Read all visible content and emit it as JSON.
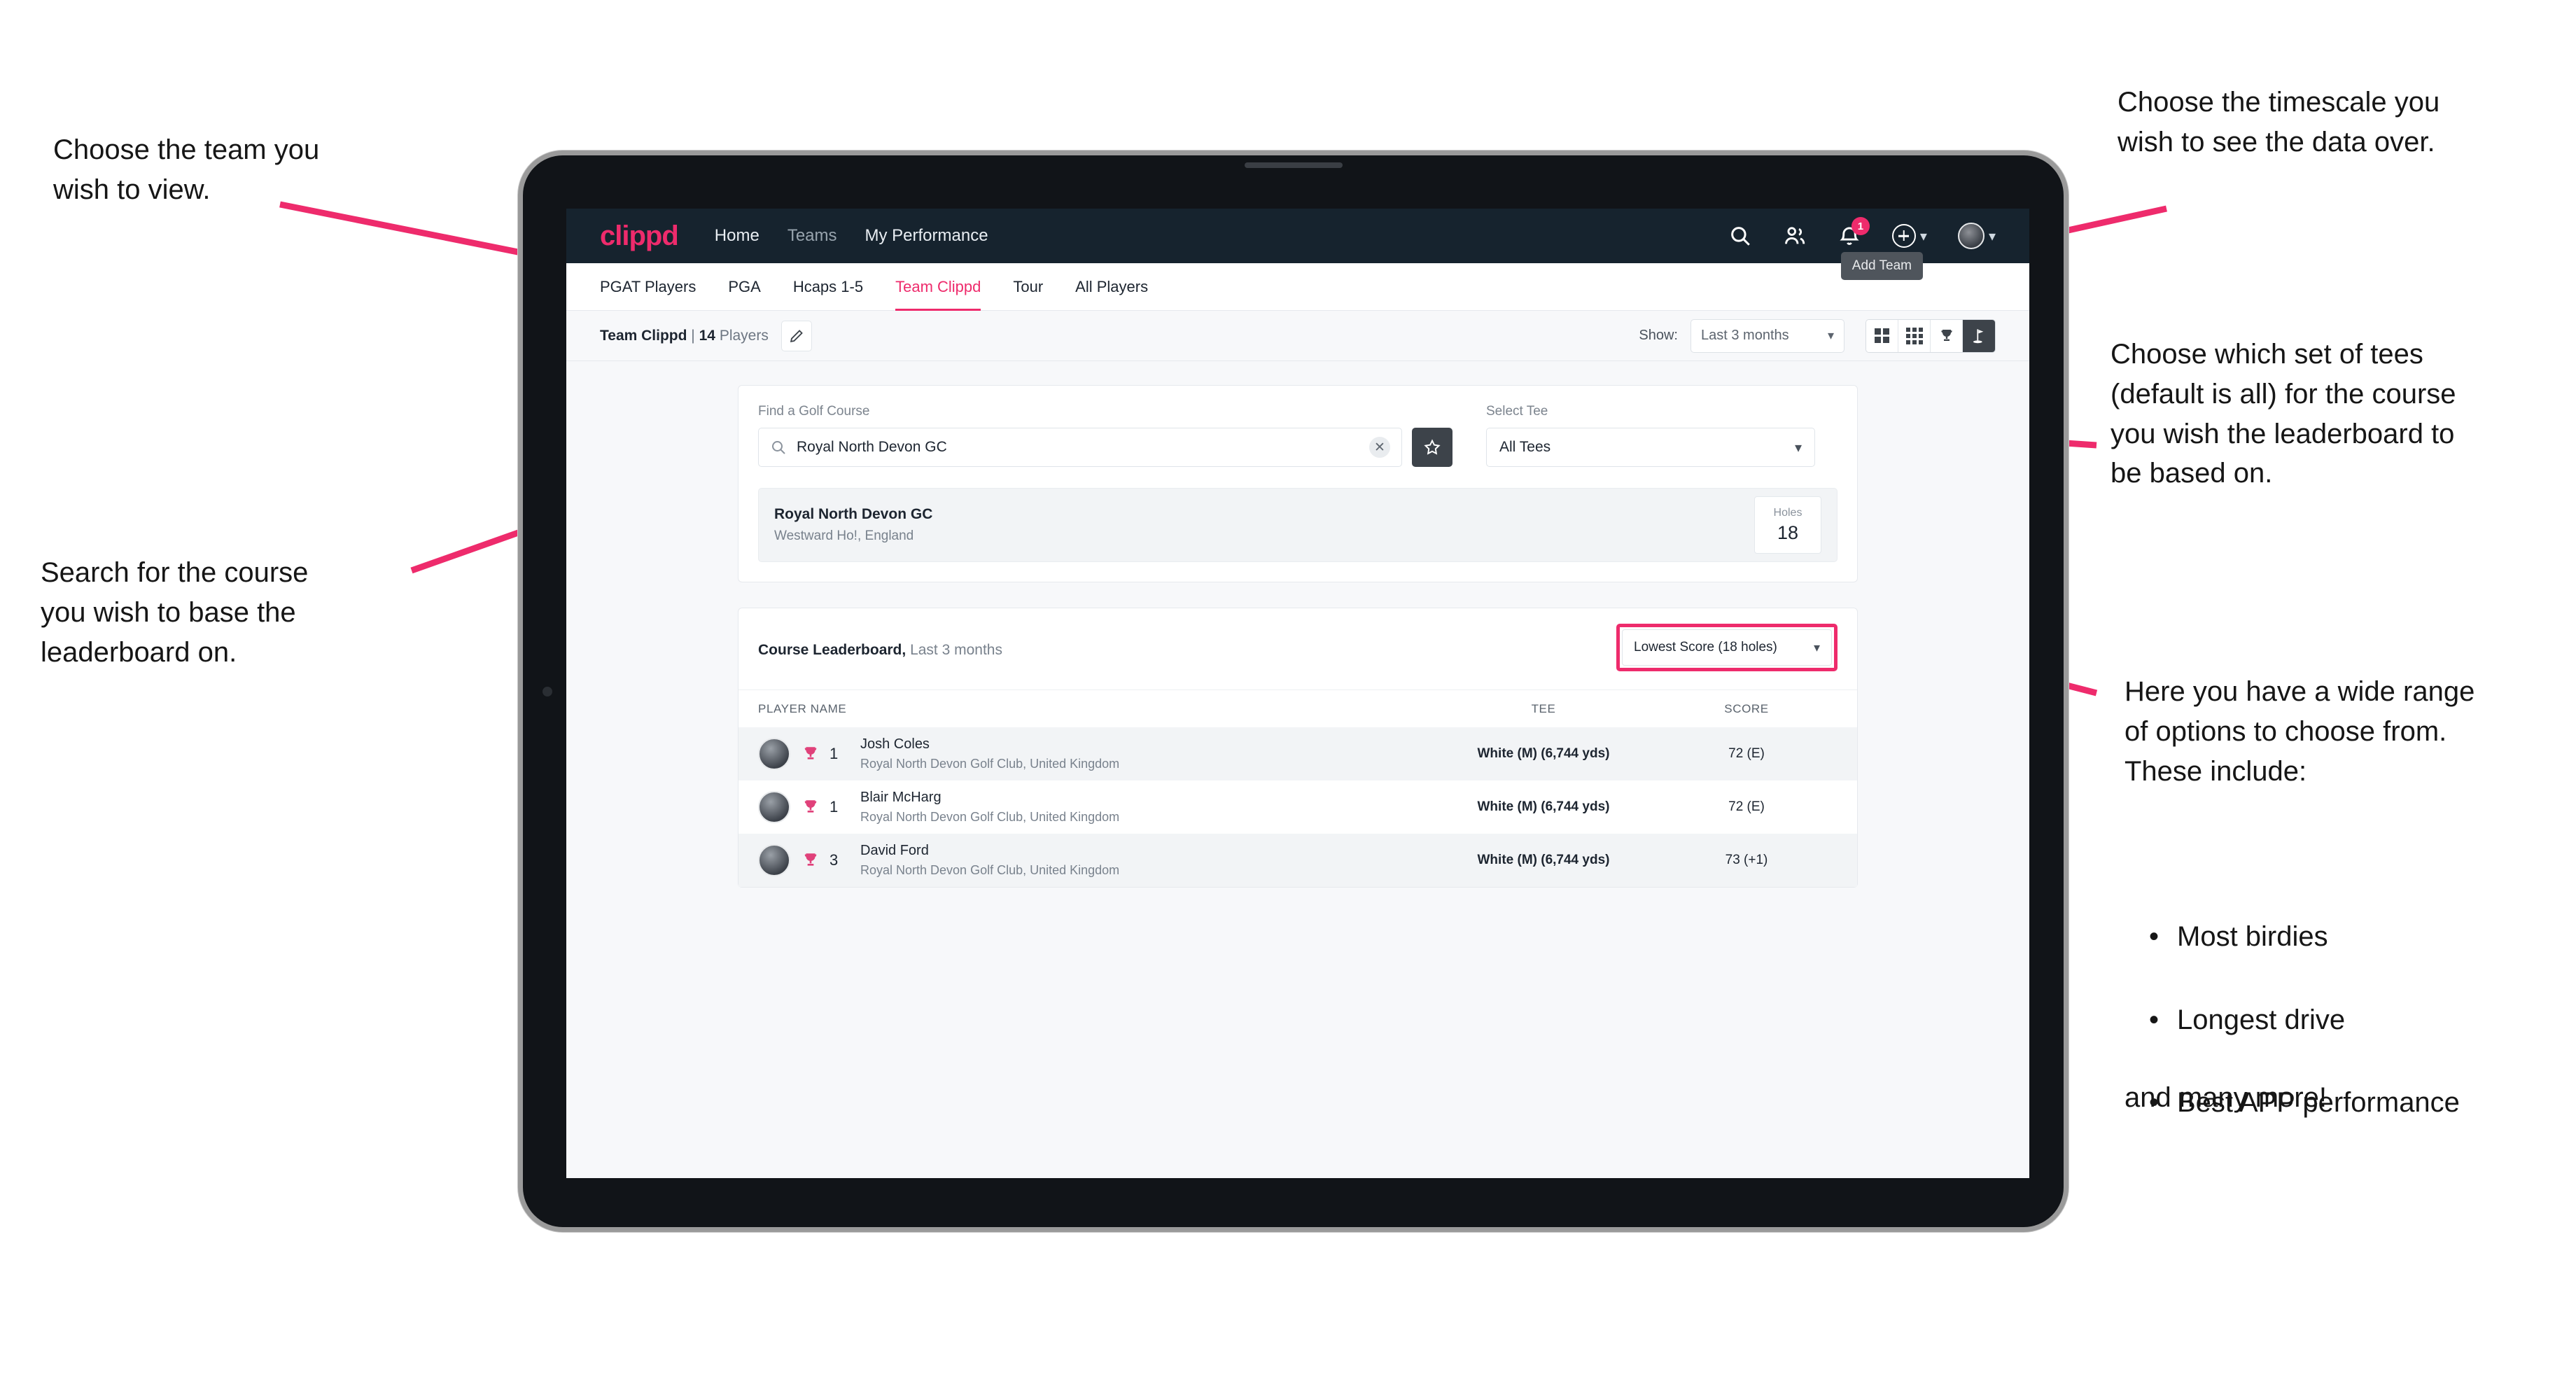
{
  "annotations": {
    "top_left": "Choose the team you\nwish to view.",
    "mid_left": "Search for the course\nyou wish to base the\nleaderboard on.",
    "top_right": "Choose the timescale you\nwish to see the data over.",
    "mid_right": "Choose which set of tees\n(default is all) for the course\nyou wish the leaderboard to\nbe based on.",
    "bottom_right_intro": "Here you have a wide range\nof options to choose from.\nThese include:",
    "bottom_right_bullets": [
      "Most birdies",
      "Longest drive",
      "Best APP performance"
    ],
    "bottom_right_outro": "and many more!",
    "arrow_color": "#ee2b6c"
  },
  "app": {
    "brand": "clippd",
    "nav_links": [
      {
        "label": "Home",
        "active": true
      },
      {
        "label": "Teams",
        "active": false
      },
      {
        "label": "My Performance",
        "active": true
      }
    ],
    "nav_icons": [
      "search-icon",
      "people-icon",
      "bell-icon",
      "plus-circle-icon",
      "avatar-icon"
    ],
    "notification_count": "1",
    "tooltip": "Add Team"
  },
  "tabs": [
    {
      "label": "PGAT Players",
      "state": "normal"
    },
    {
      "label": "PGA",
      "state": "normal"
    },
    {
      "label": "Hcaps 1-5",
      "state": "normal"
    },
    {
      "label": "Team Clippd",
      "state": "active"
    },
    {
      "label": "Tour",
      "state": "normal"
    },
    {
      "label": "All Players",
      "state": "normal"
    }
  ],
  "toolbar": {
    "team_name": "Team Clippd",
    "separator": "|",
    "player_count": "14",
    "players_word": "Players",
    "edit_icon": "pencil-icon",
    "show_label": "Show:",
    "timescale_value": "Last 3 months",
    "view_buttons": [
      {
        "name": "grid-4-view",
        "active": false
      },
      {
        "name": "grid-9-view",
        "active": false
      },
      {
        "name": "trophy-view",
        "active": false
      },
      {
        "name": "course-view",
        "active": true
      }
    ]
  },
  "search_panel": {
    "course_label": "Find a Golf Course",
    "course_value": "Royal North Devon GC",
    "course_placeholder": "Find a Golf Course",
    "clear_icon": "close-icon",
    "favourite_icon": "star-icon",
    "tee_label": "Select Tee",
    "tee_value": "All Tees"
  },
  "course_card": {
    "name": "Royal North Devon GC",
    "location": "Westward Ho!, England",
    "holes_label": "Holes",
    "holes_value": "18"
  },
  "leaderboard": {
    "title": "Course Leaderboard,",
    "subtitle": "Last 3 months",
    "sort_value": "Lowest Score (18 holes)",
    "columns": {
      "player": "PLAYER NAME",
      "tee": "TEE",
      "score": "SCORE"
    },
    "rows": [
      {
        "rank": "1",
        "name": "Josh Coles",
        "club": "Royal North Devon Golf Club, United Kingdom",
        "tee": "White (M) (6,744 yds)",
        "score": "72 (E)"
      },
      {
        "rank": "1",
        "name": "Blair McHarg",
        "club": "Royal North Devon Golf Club, United Kingdom",
        "tee": "White (M) (6,744 yds)",
        "score": "72 (E)"
      },
      {
        "rank": "3",
        "name": "David Ford",
        "club": "Royal North Devon Golf Club, United Kingdom",
        "tee": "White (M) (6,744 yds)",
        "score": "73 (+1)"
      }
    ]
  }
}
